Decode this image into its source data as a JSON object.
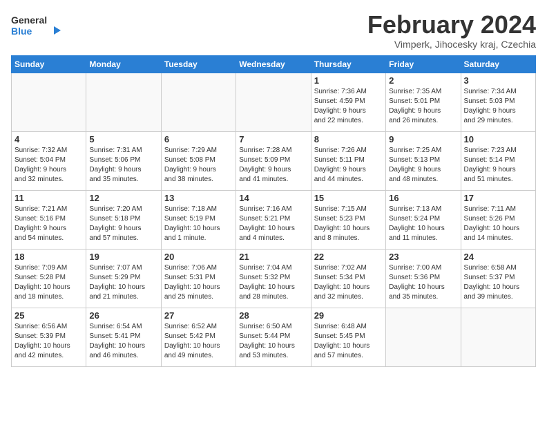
{
  "header": {
    "logo_line1": "General",
    "logo_line2": "Blue",
    "month_year": "February 2024",
    "location": "Vimperk, Jihocesky kraj, Czechia"
  },
  "days_of_week": [
    "Sunday",
    "Monday",
    "Tuesday",
    "Wednesday",
    "Thursday",
    "Friday",
    "Saturday"
  ],
  "weeks": [
    [
      {
        "day": "",
        "info": ""
      },
      {
        "day": "",
        "info": ""
      },
      {
        "day": "",
        "info": ""
      },
      {
        "day": "",
        "info": ""
      },
      {
        "day": "1",
        "info": "Sunrise: 7:36 AM\nSunset: 4:59 PM\nDaylight: 9 hours\nand 22 minutes."
      },
      {
        "day": "2",
        "info": "Sunrise: 7:35 AM\nSunset: 5:01 PM\nDaylight: 9 hours\nand 26 minutes."
      },
      {
        "day": "3",
        "info": "Sunrise: 7:34 AM\nSunset: 5:03 PM\nDaylight: 9 hours\nand 29 minutes."
      }
    ],
    [
      {
        "day": "4",
        "info": "Sunrise: 7:32 AM\nSunset: 5:04 PM\nDaylight: 9 hours\nand 32 minutes."
      },
      {
        "day": "5",
        "info": "Sunrise: 7:31 AM\nSunset: 5:06 PM\nDaylight: 9 hours\nand 35 minutes."
      },
      {
        "day": "6",
        "info": "Sunrise: 7:29 AM\nSunset: 5:08 PM\nDaylight: 9 hours\nand 38 minutes."
      },
      {
        "day": "7",
        "info": "Sunrise: 7:28 AM\nSunset: 5:09 PM\nDaylight: 9 hours\nand 41 minutes."
      },
      {
        "day": "8",
        "info": "Sunrise: 7:26 AM\nSunset: 5:11 PM\nDaylight: 9 hours\nand 44 minutes."
      },
      {
        "day": "9",
        "info": "Sunrise: 7:25 AM\nSunset: 5:13 PM\nDaylight: 9 hours\nand 48 minutes."
      },
      {
        "day": "10",
        "info": "Sunrise: 7:23 AM\nSunset: 5:14 PM\nDaylight: 9 hours\nand 51 minutes."
      }
    ],
    [
      {
        "day": "11",
        "info": "Sunrise: 7:21 AM\nSunset: 5:16 PM\nDaylight: 9 hours\nand 54 minutes."
      },
      {
        "day": "12",
        "info": "Sunrise: 7:20 AM\nSunset: 5:18 PM\nDaylight: 9 hours\nand 57 minutes."
      },
      {
        "day": "13",
        "info": "Sunrise: 7:18 AM\nSunset: 5:19 PM\nDaylight: 10 hours\nand 1 minute."
      },
      {
        "day": "14",
        "info": "Sunrise: 7:16 AM\nSunset: 5:21 PM\nDaylight: 10 hours\nand 4 minutes."
      },
      {
        "day": "15",
        "info": "Sunrise: 7:15 AM\nSunset: 5:23 PM\nDaylight: 10 hours\nand 8 minutes."
      },
      {
        "day": "16",
        "info": "Sunrise: 7:13 AM\nSunset: 5:24 PM\nDaylight: 10 hours\nand 11 minutes."
      },
      {
        "day": "17",
        "info": "Sunrise: 7:11 AM\nSunset: 5:26 PM\nDaylight: 10 hours\nand 14 minutes."
      }
    ],
    [
      {
        "day": "18",
        "info": "Sunrise: 7:09 AM\nSunset: 5:28 PM\nDaylight: 10 hours\nand 18 minutes."
      },
      {
        "day": "19",
        "info": "Sunrise: 7:07 AM\nSunset: 5:29 PM\nDaylight: 10 hours\nand 21 minutes."
      },
      {
        "day": "20",
        "info": "Sunrise: 7:06 AM\nSunset: 5:31 PM\nDaylight: 10 hours\nand 25 minutes."
      },
      {
        "day": "21",
        "info": "Sunrise: 7:04 AM\nSunset: 5:32 PM\nDaylight: 10 hours\nand 28 minutes."
      },
      {
        "day": "22",
        "info": "Sunrise: 7:02 AM\nSunset: 5:34 PM\nDaylight: 10 hours\nand 32 minutes."
      },
      {
        "day": "23",
        "info": "Sunrise: 7:00 AM\nSunset: 5:36 PM\nDaylight: 10 hours\nand 35 minutes."
      },
      {
        "day": "24",
        "info": "Sunrise: 6:58 AM\nSunset: 5:37 PM\nDaylight: 10 hours\nand 39 minutes."
      }
    ],
    [
      {
        "day": "25",
        "info": "Sunrise: 6:56 AM\nSunset: 5:39 PM\nDaylight: 10 hours\nand 42 minutes."
      },
      {
        "day": "26",
        "info": "Sunrise: 6:54 AM\nSunset: 5:41 PM\nDaylight: 10 hours\nand 46 minutes."
      },
      {
        "day": "27",
        "info": "Sunrise: 6:52 AM\nSunset: 5:42 PM\nDaylight: 10 hours\nand 49 minutes."
      },
      {
        "day": "28",
        "info": "Sunrise: 6:50 AM\nSunset: 5:44 PM\nDaylight: 10 hours\nand 53 minutes."
      },
      {
        "day": "29",
        "info": "Sunrise: 6:48 AM\nSunset: 5:45 PM\nDaylight: 10 hours\nand 57 minutes."
      },
      {
        "day": "",
        "info": ""
      },
      {
        "day": "",
        "info": ""
      }
    ]
  ]
}
